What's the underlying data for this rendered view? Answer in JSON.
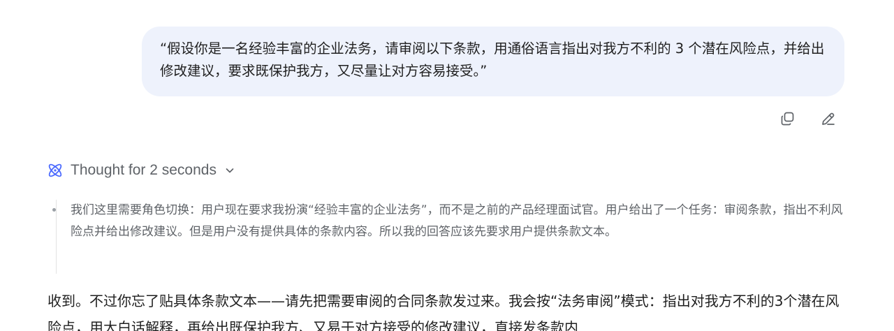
{
  "user_message": {
    "text": "“假设你是一名经验丰富的企业法务，请审阅以下条款，用通俗语言指出对我方不利的 3 个潜在风险点，并给出修改建议，要求既保护我方，又尽量让对方容易接受。”"
  },
  "message_actions": {
    "copy_icon": "copy-icon",
    "edit_icon": "edit-pencil-icon"
  },
  "thought": {
    "header_label": "Thought for 2 seconds",
    "icon": "atom-icon",
    "toggle_icon": "chevron-down-icon",
    "content": "我们这里需要角色切换：用户现在要求我扮演“经验丰富的企业法务”，而不是之前的产品经理面试官。用户给出了一个任务：审阅条款，指出不利风险点并给出修改建议。但是用户没有提供具体的条款内容。所以我的回答应该先要求用户提供条款文本。"
  },
  "assistant_answer": {
    "text": "收到。不过你忘了贴具体条款文本——请先把需要审阅的合同条款发过来。我会按“法务审阅”模式：指出对我方不利的3个潜在风险点，用大白话解释，再给出既保护我方、又易于对方接受的修改建议，直接发条款内"
  },
  "colors": {
    "bubble_bg": "#eef2fc",
    "accent_blue": "#4d6bfe",
    "muted_text": "#5f6368"
  }
}
